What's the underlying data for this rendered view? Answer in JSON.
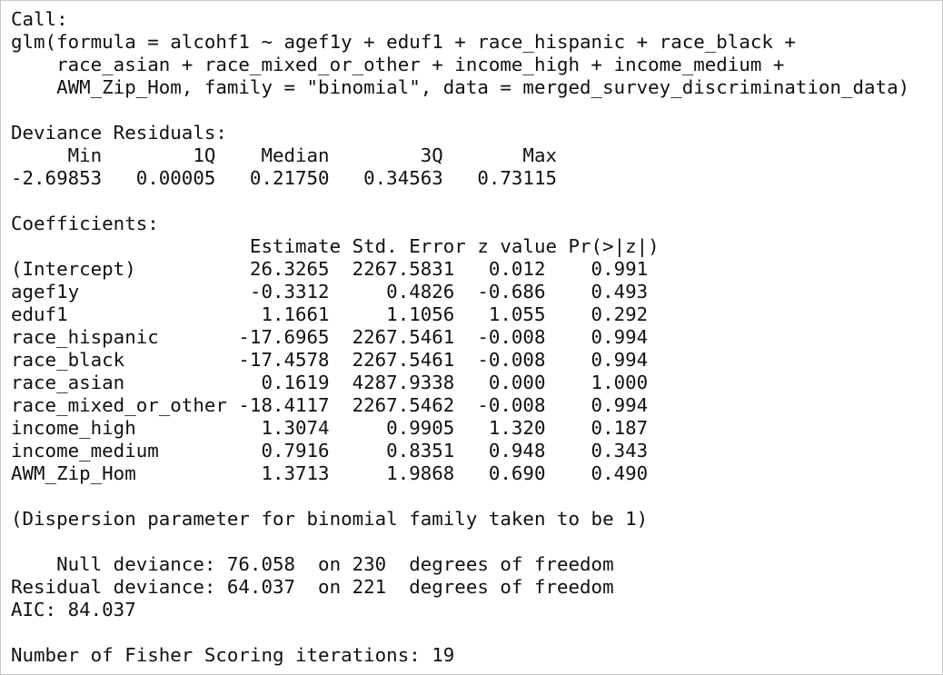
{
  "console": {
    "lines": [
      "Call:",
      "glm(formula = alcohf1 ~ agef1y + eduf1 + race_hispanic + race_black + ",
      "    race_asian + race_mixed_or_other + income_high + income_medium + ",
      "    AWM_Zip_Hom, family = \"binomial\", data = merged_survey_discrimination_data)",
      "",
      "Deviance Residuals: ",
      "     Min        1Q    Median        3Q       Max  ",
      "-2.69853   0.00005   0.21750   0.34563   0.73115  ",
      "",
      "Coefficients:",
      "                     Estimate Std. Error z value Pr(>|z|)",
      "(Intercept)          26.3265  2267.5831   0.012    0.991",
      "agef1y               -0.3312     0.4826  -0.686    0.493",
      "eduf1                 1.1661     1.1056   1.055    0.292",
      "race_hispanic       -17.6965  2267.5461  -0.008    0.994",
      "race_black          -17.4578  2267.5461  -0.008    0.994",
      "race_asian            0.1619  4287.9338   0.000    1.000",
      "race_mixed_or_other -18.4117  2267.5462  -0.008    0.994",
      "income_high           1.3074     0.9905   1.320    0.187",
      "income_medium         0.7916     0.8351   0.948    0.343",
      "AWM_Zip_Hom           1.3713     1.9868   0.690    0.490",
      "",
      "(Dispersion parameter for binomial family taken to be 1)",
      "",
      "    Null deviance: 76.058  on 230  degrees of freedom",
      "Residual deviance: 64.037  on 221  degrees of freedom",
      "AIC: 84.037",
      "",
      "Number of Fisher Scoring iterations: 19"
    ]
  }
}
